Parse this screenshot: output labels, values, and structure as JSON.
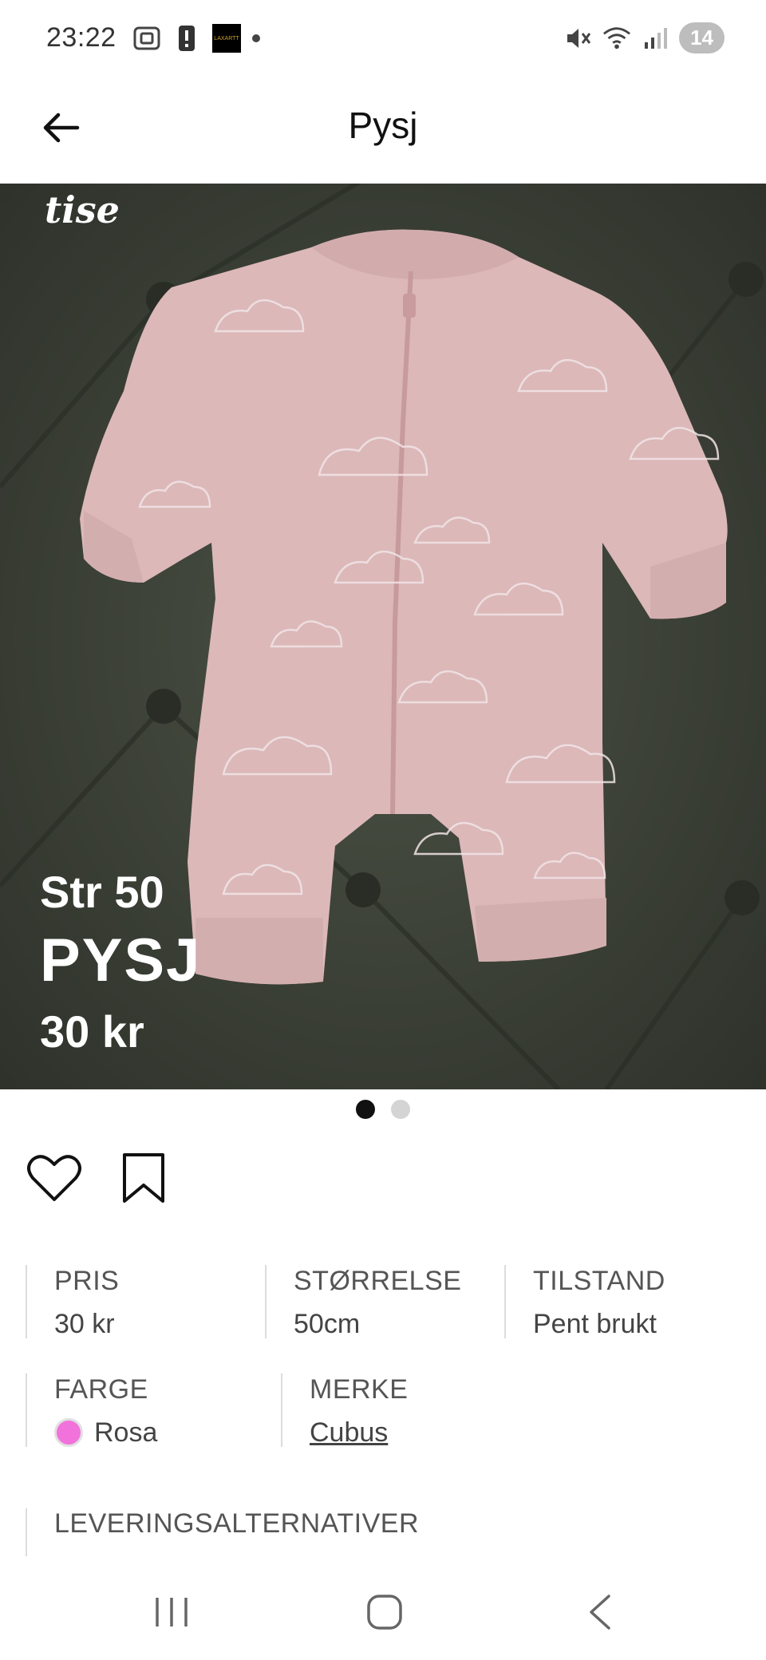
{
  "status_bar": {
    "time": "23:22",
    "app_thumb_label": "LAXARTT",
    "notification_count": "14",
    "icons": [
      "screenshot-icon",
      "alert-icon",
      "app-thumbnail",
      "dot-icon",
      "mute-icon",
      "wifi-icon",
      "signal-icon"
    ]
  },
  "header": {
    "title": "Pysj",
    "back_icon": "arrow-left-icon"
  },
  "hero": {
    "watermark": "tise",
    "overlay_size": "Str 50",
    "overlay_name": "PYSJ",
    "overlay_price": "30 kr",
    "image_count": 2,
    "active_index": 0
  },
  "actions": {
    "like_icon": "heart-icon",
    "save_icon": "bookmark-icon"
  },
  "details": {
    "price_label": "PRIS",
    "price_value": "30 kr",
    "size_label": "STØRRELSE",
    "size_value": "50cm",
    "condition_label": "TILSTAND",
    "condition_value": "Pent brukt",
    "color_label": "FARGE",
    "color_value": "Rosa",
    "color_hex": "#f272dc",
    "brand_label": "MERKE",
    "brand_value": "Cubus",
    "delivery_label": "LEVERINGSALTERNATIVER"
  },
  "nav_bar": {
    "icons": [
      "recent-apps-icon",
      "home-icon",
      "back-icon"
    ]
  }
}
